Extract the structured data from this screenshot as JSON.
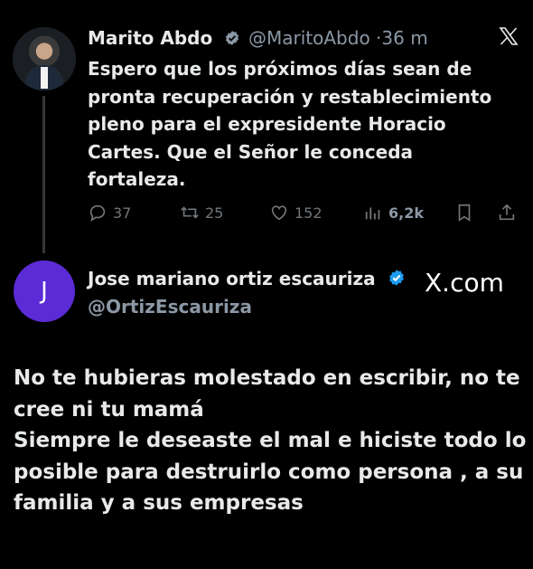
{
  "quoted_tweet": {
    "author_name": "Marito Abdo",
    "handle": "@MaritoAbdo",
    "separator": "·",
    "time": "36 m",
    "text_lines": [
      "Espero que los próximos días sean de",
      "pronta recuperación y restablecimiento",
      "pleno para el expresidente Horacio",
      "Cartes. Que el Señor le conceda",
      "fortaleza."
    ],
    "stats": {
      "replies": "37",
      "reposts": "25",
      "likes": "152",
      "views": "6,2k"
    }
  },
  "reply": {
    "avatar_letter": "J",
    "author_name": "Jose mariano ortiz escauriza",
    "handle": "@OrtizEscauriza",
    "brand": "X.com",
    "text_lines": [
      "No te hubieras molestado en escribir, no te",
      "cree ni tu mamá",
      "Siempre le deseaste el mal e hiciste todo lo",
      "posible para destruirlo como persona , a su",
      "familia y a sus empresas"
    ]
  },
  "colors": {
    "background": "#000000",
    "text_primary": "#e7e9ea",
    "text_secondary": "#71767b",
    "verified_blue": "#1d9bf0",
    "avatar_purple": "#5b2bd6"
  }
}
